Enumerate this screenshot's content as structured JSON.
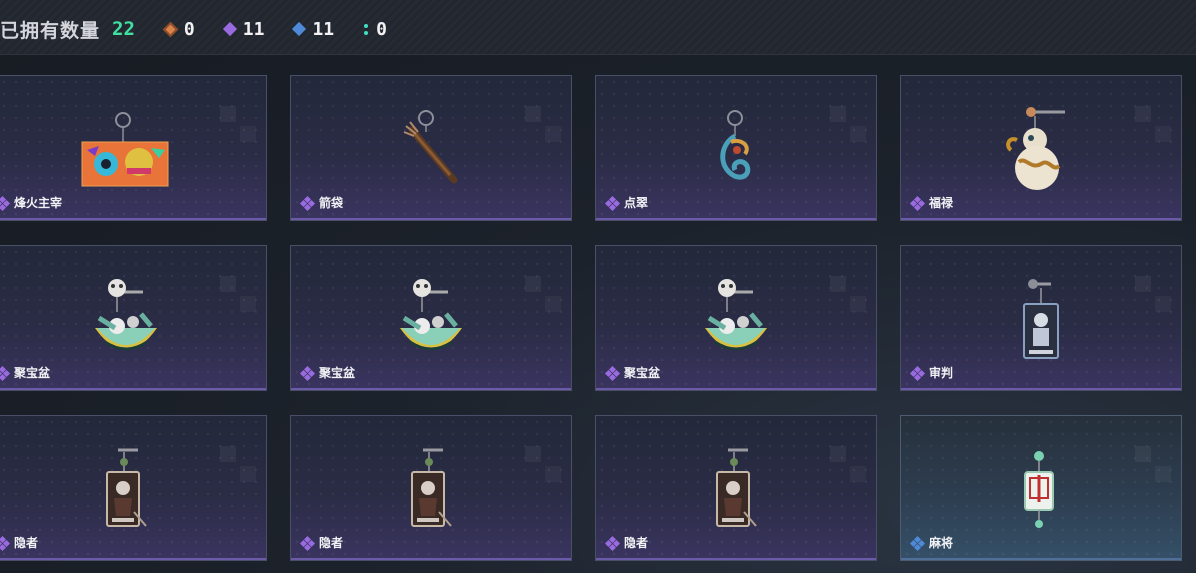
{
  "header": {
    "owned_label": "已拥有数量",
    "owned_count": "22",
    "stats": [
      {
        "icon": "orange-gem-icon",
        "color": "#d9824a",
        "value": "0"
      },
      {
        "icon": "purple-gem-icon",
        "color": "#9a6be0",
        "value": "11"
      },
      {
        "icon": "blue-gem-icon",
        "color": "#4f8ad8",
        "value": "11"
      },
      {
        "icon": "teal-dots-icon",
        "color": "#3fe0c0",
        "value": "0"
      }
    ]
  },
  "items": [
    {
      "name": "烽火主宰",
      "rarity": "purple",
      "icon": "graffiti-plate-charm-icon"
    },
    {
      "name": "箭袋",
      "rarity": "purple",
      "icon": "quiver-charm-icon"
    },
    {
      "name": "点翠",
      "rarity": "purple",
      "icon": "phoenix-charm-icon"
    },
    {
      "name": "福禄",
      "rarity": "purple",
      "icon": "gourd-charm-icon"
    },
    {
      "name": "聚宝盆",
      "rarity": "purple",
      "icon": "treasure-bowl-charm-icon"
    },
    {
      "name": "聚宝盆",
      "rarity": "purple",
      "icon": "treasure-bowl-charm-icon"
    },
    {
      "name": "聚宝盆",
      "rarity": "purple",
      "icon": "treasure-bowl-charm-icon"
    },
    {
      "name": "审判",
      "rarity": "purple",
      "icon": "judgement-card-charm-icon"
    },
    {
      "name": "隐者",
      "rarity": "purple",
      "icon": "hermit-card-charm-icon"
    },
    {
      "name": "隐者",
      "rarity": "purple",
      "icon": "hermit-card-charm-icon"
    },
    {
      "name": "隐者",
      "rarity": "purple",
      "icon": "hermit-card-charm-icon"
    },
    {
      "name": "麻将",
      "rarity": "blue",
      "icon": "mahjong-tile-charm-icon"
    }
  ],
  "colors": {
    "owned_count": "#3fe0a0",
    "purple": "#9a6be0",
    "blue": "#4f8ad8"
  }
}
